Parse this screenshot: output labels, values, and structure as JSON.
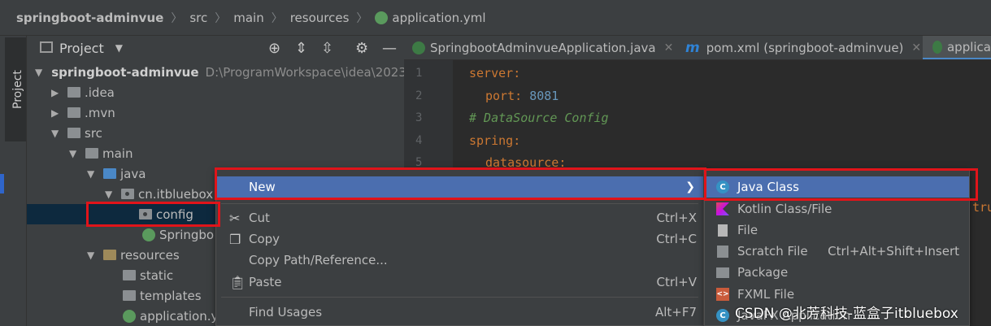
{
  "breadcrumb": {
    "items": [
      "springboot-adminvue",
      "src",
      "main",
      "resources",
      "application.yml"
    ]
  },
  "toolstrip": {
    "project_tab": "Project"
  },
  "project_panel": {
    "title": "Project",
    "tree": [
      {
        "label": "springboot-adminvue",
        "path": "D:\\ProgramWorkspace\\idea\\2023"
      },
      {
        "label": ".idea"
      },
      {
        "label": ".mvn"
      },
      {
        "label": "src"
      },
      {
        "label": "main"
      },
      {
        "label": "java"
      },
      {
        "label": "cn.itbluebox"
      },
      {
        "label": "config"
      },
      {
        "label": "Springbo"
      },
      {
        "label": "resources"
      },
      {
        "label": "static"
      },
      {
        "label": "templates"
      },
      {
        "label": "application.y"
      }
    ]
  },
  "tabs": [
    {
      "label": "SpringbootAdminvueApplication.java"
    },
    {
      "label": "pom.xml (springboot-adminvue)"
    },
    {
      "label": "applica"
    }
  ],
  "editor": {
    "line_numbers": [
      "1",
      "2",
      "3",
      "4",
      "5"
    ],
    "lines": [
      {
        "key": "server",
        "rest": ":"
      },
      {
        "key": "port",
        "rest": ": ",
        "value": "8081"
      },
      {
        "comment": "# DataSource Config"
      },
      {
        "key": "spring",
        "rest": ":"
      },
      {
        "key": "datasource",
        "rest": ":"
      }
    ],
    "trailing_text": "tru"
  },
  "context_menu": {
    "items": [
      {
        "label": "New",
        "has_submenu": true
      },
      {
        "label": "Cut",
        "shortcut": "Ctrl+X",
        "icon": "scissors-icon"
      },
      {
        "label": "Copy",
        "shortcut": "Ctrl+C",
        "icon": "copy-icon"
      },
      {
        "label": "Copy Path/Reference..."
      },
      {
        "label": "Paste",
        "shortcut": "Ctrl+V",
        "icon": "clipboard-icon"
      },
      {
        "label": "Find Usages",
        "shortcut": "Alt+F7"
      }
    ]
  },
  "submenu": {
    "items": [
      {
        "label": "Java Class",
        "icon": "java-class-icon",
        "glyph": "C"
      },
      {
        "label": "Kotlin Class/File",
        "icon": "kotlin-icon"
      },
      {
        "label": "File",
        "icon": "file-icon"
      },
      {
        "label": "Scratch File",
        "shortcut": "Ctrl+Alt+Shift+Insert",
        "icon": "scratch-file-icon"
      },
      {
        "label": "Package",
        "icon": "package-icon"
      },
      {
        "label": "FXML File",
        "icon": "fxml-icon",
        "glyph": "<>"
      },
      {
        "label": "JavaFX Application",
        "icon": "javafx-icon",
        "glyph": "C"
      }
    ]
  },
  "watermark": "CSDN @北芳科技-蓝盒子itbluebox",
  "colors": {
    "highlight": "#4b6eaf",
    "annotation_red": "#e0141a",
    "selection": "#0d293e"
  }
}
